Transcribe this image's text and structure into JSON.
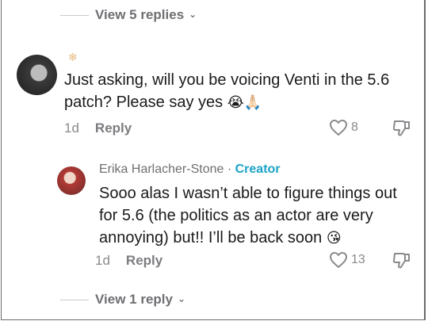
{
  "top_toggle": {
    "label": "View 5 replies"
  },
  "main_comment": {
    "text": "Just asking, will you be voicing Venti in the 5.6 patch? Please say yes",
    "emoji": "😭🙏🏻",
    "time": "1d",
    "reply_label": "Reply",
    "likes": "8"
  },
  "creator_reply": {
    "author": "Erika Harlacher-Stone",
    "separator": " · ",
    "badge": "Creator",
    "text": "Sooo alas I wasn’t able to figure things out for 5.6 (the politics as an actor are very annoying) but!! I’ll be back soon",
    "emoji": "😘",
    "time": "1d",
    "reply_label": "Reply",
    "likes": "13"
  },
  "bottom_toggle": {
    "label": "View 1 reply"
  },
  "colors": {
    "creator": "#1ba3c6",
    "secondary_text": "#8a8a8e"
  }
}
